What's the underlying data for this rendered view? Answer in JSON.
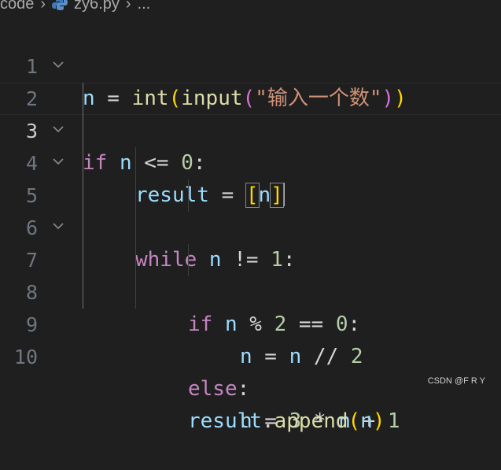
{
  "breadcrumb": {
    "folder": "code",
    "file": "zy6.py",
    "more": "..."
  },
  "line_numbers": [
    "1",
    "2",
    "3",
    "4",
    "5",
    "6",
    "7",
    "8",
    "9",
    "10"
  ],
  "code": {
    "l1": [
      "n",
      " = ",
      "int",
      "(",
      "input",
      "(",
      "\"输入一个数\"",
      ")",
      ")"
    ],
    "l2": [
      "if",
      " n ",
      "<=",
      " ",
      "0",
      ":"
    ],
    "l3": [
      "result",
      " = ",
      "[",
      "n",
      "]"
    ],
    "l4": [
      "while",
      " n ",
      "!=",
      " ",
      "1",
      ":"
    ],
    "l5": [
      "if",
      " n ",
      "%",
      " ",
      "2",
      " == ",
      "0",
      ":"
    ],
    "l6": [
      "n",
      " = ",
      "n",
      " // ",
      "2"
    ],
    "l7": [
      "else",
      ":"
    ],
    "l8": [
      "n",
      " = ",
      "3",
      " * ",
      "n",
      " + ",
      "1"
    ],
    "l9": [
      "result",
      ".",
      "append",
      "(",
      "n",
      ")"
    ]
  },
  "colors": {
    "background": "#1f1f1f",
    "keyword": "#c586c0",
    "variable": "#9cdcfe",
    "function": "#dcdcaa",
    "number": "#b5cea8",
    "string": "#ce9178",
    "bracket": "#ffd700"
  },
  "watermark": "CSDN @F R  Y"
}
